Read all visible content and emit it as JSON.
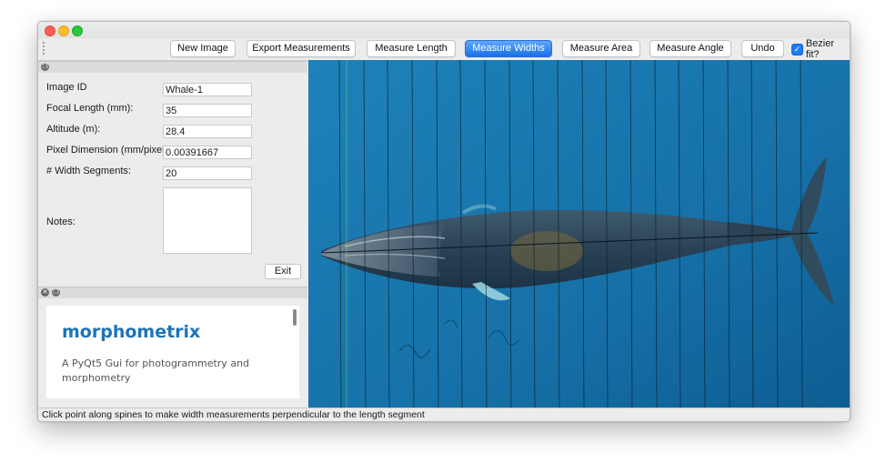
{
  "toolbar": {
    "buttons": [
      "New Image",
      "Export Measurements",
      "Measure Length",
      "Measure Widths",
      "Measure Area",
      "Measure Angle",
      "Undo"
    ],
    "active_button": "Measure Widths",
    "checkbox_label": "Bezier fit?",
    "checkbox_checked": true
  },
  "form": {
    "image_id": {
      "label": "Image ID",
      "value": "Whale-1"
    },
    "focal_length": {
      "label": "Focal Length (mm):",
      "value": "35"
    },
    "altitude": {
      "label": "Altitude (m):",
      "value": "28.4"
    },
    "pixel_dimension": {
      "label": "Pixel Dimension (mm/pixel)",
      "value": "0.00391667"
    },
    "width_segments": {
      "label": "# Width Segments:",
      "value": "20"
    },
    "notes": {
      "label": "Notes:",
      "value": ""
    },
    "exit_label": "Exit"
  },
  "about": {
    "title": "morphometrix",
    "description": "A PyQt5 Gui for photogrammetry and morphometry"
  },
  "status_text": "Click point along spines to make width measurements perpendicular to the length segment",
  "colors": {
    "accent": "#1a6fe8",
    "title_blue": "#1d74b8",
    "ocean": "#156fa6"
  },
  "icons": {
    "dock_float": "float-icon",
    "dock_close": "close-icon",
    "checkbox": "checkmark-icon"
  }
}
